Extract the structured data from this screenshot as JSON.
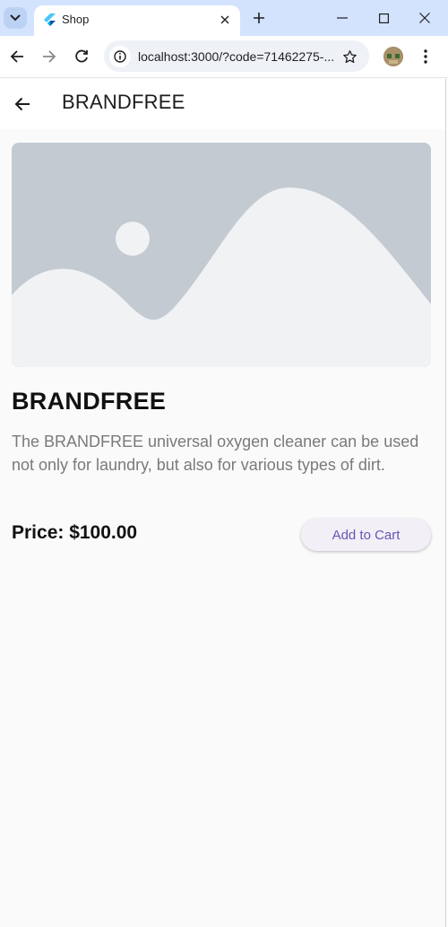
{
  "browser": {
    "tab": {
      "title": "Shop"
    },
    "omnibox": {
      "url": "localhost:3000/?code=71462275-..."
    }
  },
  "appbar": {
    "title": "BRANDFREE"
  },
  "product": {
    "title": "BRANDFREE",
    "description": "The BRANDFREE universal oxygen cleaner can be used not only for laundry, but also for various types of dirt.",
    "price": "Price: $100.00",
    "add_to_cart_label": "Add to Cart"
  },
  "colors": {
    "browser_frame": "#d3e3fd",
    "accent": "#6a55b3",
    "button_bg": "#f3eff7",
    "placeholder_bg": "#c3cad2",
    "placeholder_fg": "#f1f2f4"
  },
  "icons": [
    "tab-list-icon",
    "flutter-icon",
    "close-icon",
    "plus-icon",
    "minimize-icon",
    "maximize-icon",
    "window-close-icon",
    "back-icon",
    "forward-icon",
    "reload-icon",
    "site-info-icon",
    "star-icon",
    "profile-avatar",
    "more-vert-icon",
    "arrow-back-icon",
    "image-placeholder-icon"
  ]
}
